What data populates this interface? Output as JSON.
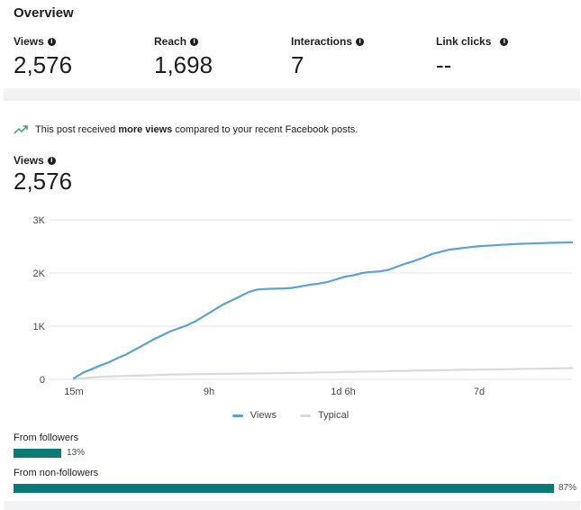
{
  "overview": {
    "title": "Overview",
    "metrics": [
      {
        "label": "Views",
        "value": "2,576"
      },
      {
        "label": "Reach",
        "value": "1,698"
      },
      {
        "label": "Interactions",
        "value": "7"
      },
      {
        "label": "Link clicks",
        "value": "--"
      }
    ]
  },
  "insight": {
    "prefix": "This post received ",
    "bold": "more views",
    "suffix": " compared to your recent Facebook posts."
  },
  "views_section": {
    "label": "Views",
    "value": "2,576"
  },
  "colors": {
    "views": "#5ba4d0",
    "typical": "#d8dadf",
    "bar": "#0b7a75",
    "grid": "#e4e6eb"
  },
  "icons": {
    "info": "info-icon",
    "trend": "trend-up-icon"
  },
  "chart_data": {
    "type": "line",
    "x_ticks": [
      "15m",
      "9h",
      "1d 6h",
      "7d"
    ],
    "y_ticks": [
      "0",
      "1K",
      "2K",
      "3K"
    ],
    "ylim": [
      0,
      3000
    ],
    "legend_position": "bottom",
    "grid": true,
    "series": [
      {
        "name": "Views",
        "values": [
          20,
          120,
          190,
          260,
          320,
          400,
          470,
          560,
          650,
          740,
          820,
          900,
          960,
          1020,
          1100,
          1200,
          1300,
          1400,
          1480,
          1560,
          1640,
          1690,
          1700,
          1705,
          1710,
          1720,
          1750,
          1780,
          1800,
          1830,
          1880,
          1930,
          1960,
          2000,
          2020,
          2030,
          2060,
          2120,
          2180,
          2230,
          2290,
          2360,
          2400,
          2440,
          2460,
          2480,
          2500,
          2510,
          2520,
          2530,
          2540,
          2550,
          2555,
          2560,
          2565,
          2570,
          2573,
          2576
        ]
      },
      {
        "name": "Typical",
        "values": [
          0,
          20,
          35,
          45,
          55,
          60,
          65,
          70,
          75,
          80,
          85,
          90,
          92,
          95,
          98,
          100,
          102,
          104,
          106,
          108,
          110,
          112,
          114,
          116,
          118,
          120,
          122,
          125,
          128,
          130,
          135,
          140,
          142,
          145,
          148,
          150,
          155,
          158,
          160,
          165,
          168,
          170,
          172,
          175,
          178,
          180,
          182,
          185,
          188,
          190,
          192,
          195,
          198,
          200,
          202,
          205,
          208,
          210
        ]
      }
    ]
  },
  "audience": {
    "followers": {
      "label": "From followers",
      "percent": 13,
      "percent_label": "13%"
    },
    "non_followers": {
      "label": "From non-followers",
      "percent": 87,
      "percent_label": "87%"
    }
  }
}
